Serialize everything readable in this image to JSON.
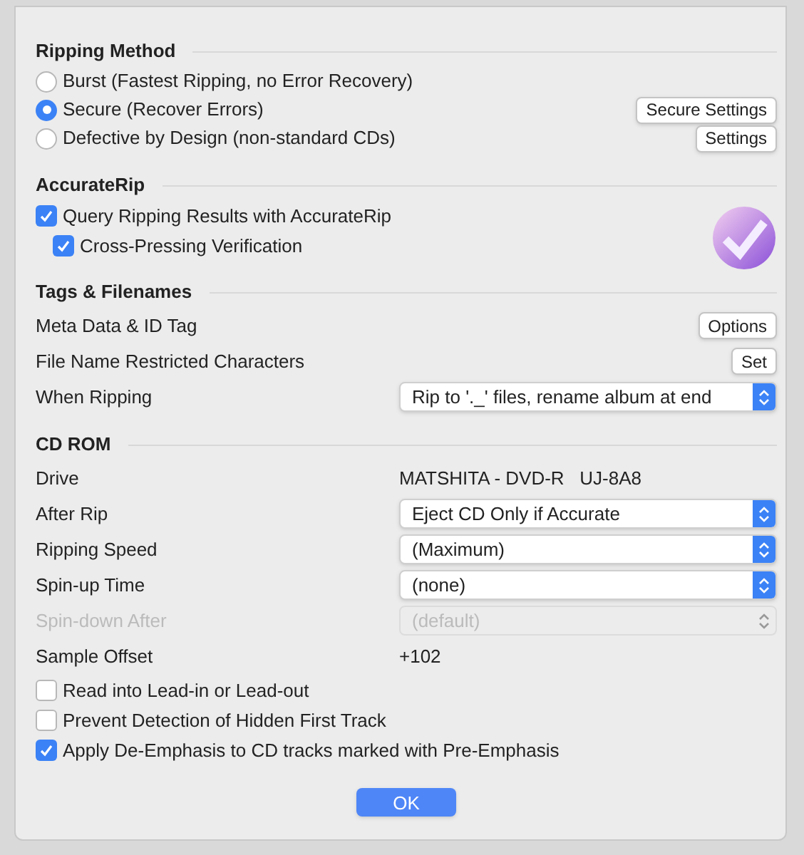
{
  "ripping_method": {
    "title": "Ripping Method",
    "options": [
      {
        "label": "Burst (Fastest Ripping, no Error Recovery)",
        "selected": false
      },
      {
        "label": "Secure (Recover Errors)",
        "selected": true,
        "button": "Secure Settings"
      },
      {
        "label": "Defective by Design (non-standard CDs)",
        "selected": false,
        "button": "Settings"
      }
    ]
  },
  "accuraterip": {
    "title": "AccurateRip",
    "checks": [
      {
        "label": "Query Ripping Results with AccurateRip",
        "checked": true,
        "children": [
          {
            "label": "Cross-Pressing Verification",
            "checked": true
          }
        ]
      }
    ]
  },
  "tags": {
    "title": "Tags & Filenames",
    "rows": [
      {
        "kind": "button",
        "label": "Meta Data & ID Tag",
        "button": "Options"
      },
      {
        "kind": "button",
        "label": "File Name Restricted Characters",
        "button": "Set"
      },
      {
        "kind": "select",
        "label": "When Ripping",
        "value": "Rip to '._' files, rename album at end",
        "disabled": false
      }
    ]
  },
  "cd_rom": {
    "title": "CD ROM",
    "rows": [
      {
        "kind": "text",
        "label": "Drive",
        "value": "MATSHITA - DVD-R   UJ-8A8"
      },
      {
        "kind": "select",
        "label": "After Rip",
        "value": "Eject CD Only if Accurate",
        "disabled": false
      },
      {
        "kind": "select",
        "label": "Ripping Speed",
        "value": "(Maximum)",
        "disabled": false
      },
      {
        "kind": "select",
        "label": "Spin-up Time",
        "value": "(none)",
        "disabled": false
      },
      {
        "kind": "select",
        "label": "Spin-down After",
        "value": "(default)",
        "disabled": true
      },
      {
        "kind": "text",
        "label": "Sample Offset",
        "value": "+102"
      }
    ],
    "checks": [
      {
        "label": "Read into Lead-in or Lead-out",
        "checked": false
      },
      {
        "label": "Prevent Detection of Hidden First Track",
        "checked": false
      },
      {
        "label": "Apply De-Emphasis to CD tracks marked with Pre-Emphasis",
        "checked": true
      }
    ]
  },
  "ok_button": "OK"
}
